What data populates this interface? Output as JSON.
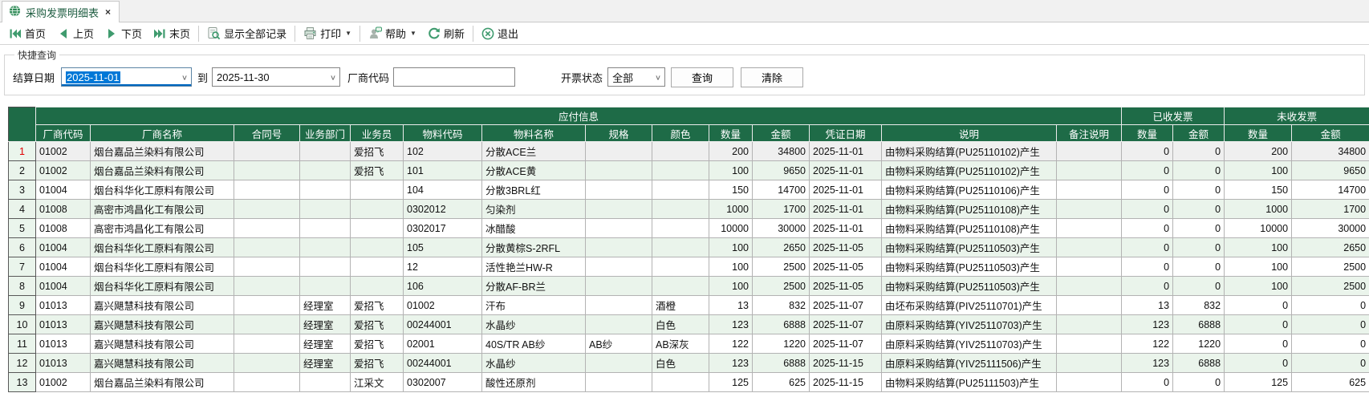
{
  "tab": {
    "title": "采购发票明细表",
    "close_glyph": "×"
  },
  "toolbar": {
    "first": "首页",
    "prev": "上页",
    "next": "下页",
    "last": "末页",
    "show_all": "显示全部记录",
    "print": "打印",
    "help": "帮助",
    "refresh": "刷新",
    "exit": "退出"
  },
  "query": {
    "legend": "快捷查询",
    "date_label": "结算日期",
    "date_from": "2025-11-01",
    "to_label": "到",
    "date_to": "2025-11-30",
    "vendor_label": "厂商代码",
    "vendor_value": "",
    "status_label": "开票状态",
    "status_value": "全部",
    "search_button": "查询",
    "clear_button": "清除"
  },
  "table": {
    "groups": {
      "payable": "应付信息",
      "received": "已收发票",
      "unreceived": "未收发票"
    },
    "columns": [
      "厂商代码",
      "厂商名称",
      "合同号",
      "业务部门",
      "业务员",
      "物料代码",
      "物料名称",
      "规格",
      "颜色",
      "数量",
      "金额",
      "凭证日期",
      "说明",
      "备注说明",
      "数量",
      "金额",
      "数量",
      "金额"
    ],
    "rows": [
      [
        "1",
        "01002",
        "烟台嘉品兰染料有限公司",
        "",
        "",
        "爱招飞",
        "102",
        "分散ACE兰",
        "",
        "",
        "200",
        "34800",
        "2025-11-01",
        "由物料采购结算(PU25110102)产生",
        "",
        "0",
        "0",
        "200",
        "34800"
      ],
      [
        "2",
        "01002",
        "烟台嘉品兰染料有限公司",
        "",
        "",
        "爱招飞",
        "101",
        "分散ACE黄",
        "",
        "",
        "100",
        "9650",
        "2025-11-01",
        "由物料采购结算(PU25110102)产生",
        "",
        "0",
        "0",
        "100",
        "9650"
      ],
      [
        "3",
        "01004",
        "烟台科华化工原料有限公司",
        "",
        "",
        "",
        "104",
        "分散3BRL红",
        "",
        "",
        "150",
        "14700",
        "2025-11-01",
        "由物料采购结算(PU25110106)产生",
        "",
        "0",
        "0",
        "150",
        "14700"
      ],
      [
        "4",
        "01008",
        "高密市鸿昌化工有限公司",
        "",
        "",
        "",
        "0302012",
        "匀染剂",
        "",
        "",
        "1000",
        "1700",
        "2025-11-01",
        "由物料采购结算(PU25110108)产生",
        "",
        "0",
        "0",
        "1000",
        "1700"
      ],
      [
        "5",
        "01008",
        "高密市鸿昌化工有限公司",
        "",
        "",
        "",
        "0302017",
        "冰醋酸",
        "",
        "",
        "10000",
        "30000",
        "2025-11-01",
        "由物料采购结算(PU25110108)产生",
        "",
        "0",
        "0",
        "10000",
        "30000"
      ],
      [
        "6",
        "01004",
        "烟台科华化工原料有限公司",
        "",
        "",
        "",
        "105",
        "分散黄棕S-2RFL",
        "",
        "",
        "100",
        "2650",
        "2025-11-05",
        "由物料采购结算(PU25110503)产生",
        "",
        "0",
        "0",
        "100",
        "2650"
      ],
      [
        "7",
        "01004",
        "烟台科华化工原料有限公司",
        "",
        "",
        "",
        "12",
        "活性艳兰HW-R",
        "",
        "",
        "100",
        "2500",
        "2025-11-05",
        "由物料采购结算(PU25110503)产生",
        "",
        "0",
        "0",
        "100",
        "2500"
      ],
      [
        "8",
        "01004",
        "烟台科华化工原料有限公司",
        "",
        "",
        "",
        "106",
        "分散AF-BR兰",
        "",
        "",
        "100",
        "2500",
        "2025-11-05",
        "由物料采购结算(PU25110503)产生",
        "",
        "0",
        "0",
        "100",
        "2500"
      ],
      [
        "9",
        "01013",
        "嘉兴飓慧科技有限公司",
        "",
        "经理室",
        "爱招飞",
        "01002",
        "汗布",
        "",
        "酒橙",
        "13",
        "832",
        "2025-11-07",
        "由坯布采购结算(PIV25110701)产生",
        "",
        "13",
        "832",
        "0",
        "0"
      ],
      [
        "10",
        "01013",
        "嘉兴飓慧科技有限公司",
        "",
        "经理室",
        "爱招飞",
        "00244001",
        "水晶纱",
        "",
        "白色",
        "123",
        "6888",
        "2025-11-07",
        "由原料采购结算(YIV25110703)产生",
        "",
        "123",
        "6888",
        "0",
        "0"
      ],
      [
        "11",
        "01013",
        "嘉兴飓慧科技有限公司",
        "",
        "经理室",
        "爱招飞",
        "02001",
        "40S/TR AB纱",
        "AB纱",
        "AB深灰",
        "122",
        "1220",
        "2025-11-07",
        "由原料采购结算(YIV25110703)产生",
        "",
        "122",
        "1220",
        "0",
        "0"
      ],
      [
        "12",
        "01013",
        "嘉兴飓慧科技有限公司",
        "",
        "经理室",
        "爱招飞",
        "00244001",
        "水晶纱",
        "",
        "白色",
        "123",
        "6888",
        "2025-11-15",
        "由原料采购结算(YIV25111506)产生",
        "",
        "123",
        "6888",
        "0",
        "0"
      ],
      [
        "13",
        "01002",
        "烟台嘉品兰染料有限公司",
        "",
        "",
        "江采文",
        "0302007",
        "酸性还原剂",
        "",
        "",
        "125",
        "625",
        "2025-11-15",
        "由物料采购结算(PU25111503)产生",
        "",
        "0",
        "0",
        "125",
        "625"
      ]
    ]
  },
  "colors": {
    "header_green": "#1e6b47",
    "icon_green": "#3f9b6e",
    "alt_row_green": "#eaf4eb",
    "rownum_bg": "#eaf5ec",
    "current_row_number_red": "#e00000",
    "selection_blue": "#0078d7"
  }
}
